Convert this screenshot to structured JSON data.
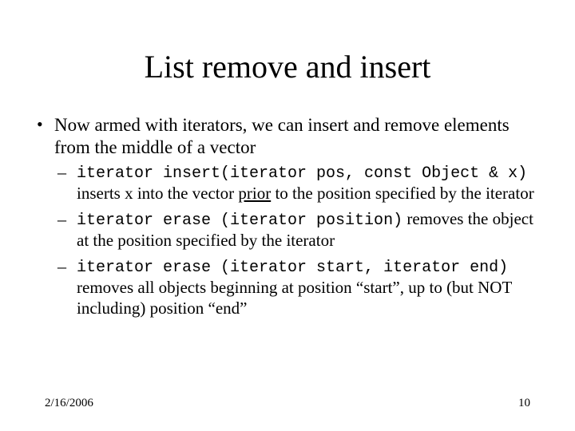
{
  "title": "List remove and insert",
  "bullet1": "Now armed with iterators, we can insert and remove elements from the middle of a vector",
  "sub1_code": "iterator insert(iterator pos, const Object & x)",
  "sub1_text_a": "inserts x into the vector ",
  "sub1_prior": "prior",
  "sub1_text_b": " to the position specified by the iterator",
  "sub2_code": "iterator erase (iterator position)",
  "sub2_text": " removes the object at the position specified by the iterator",
  "sub3_code": "iterator erase (iterator start, iterator end)",
  "sub3_text": "removes all objects beginning at position “start”, up to (but NOT including) position “end”",
  "footer_date": "2/16/2006",
  "footer_page": "10"
}
